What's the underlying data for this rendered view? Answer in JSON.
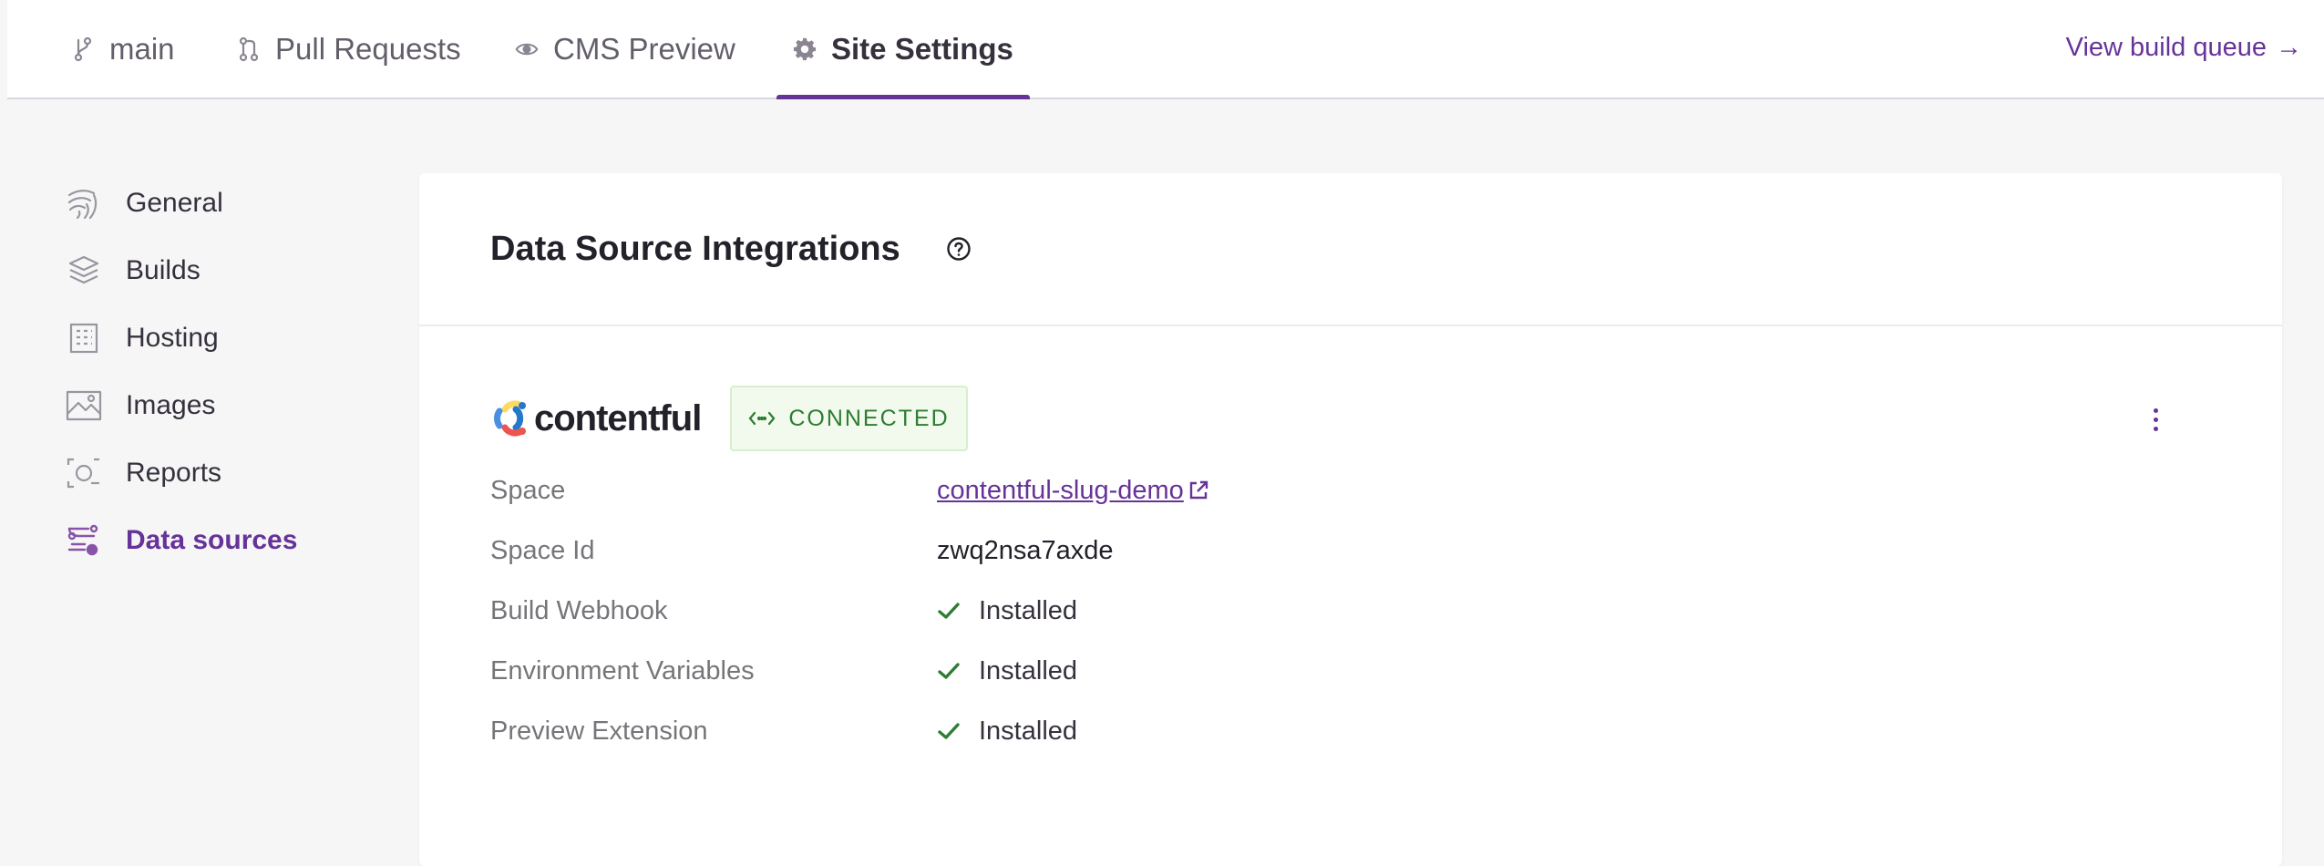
{
  "tabs": [
    {
      "label": "main",
      "icon": "git-branch-icon"
    },
    {
      "label": "Pull Requests",
      "icon": "pull-request-icon"
    },
    {
      "label": "CMS Preview",
      "icon": "eye-icon"
    },
    {
      "label": "Site Settings",
      "icon": "gear-icon",
      "active": true
    }
  ],
  "header": {
    "build_queue_label": "View build queue",
    "build_queue_arrow": "→"
  },
  "sidebar": {
    "items": [
      {
        "label": "General",
        "icon": "general-icon"
      },
      {
        "label": "Builds",
        "icon": "layers-icon"
      },
      {
        "label": "Hosting",
        "icon": "building-icon"
      },
      {
        "label": "Images",
        "icon": "image-icon"
      },
      {
        "label": "Reports",
        "icon": "reports-icon"
      },
      {
        "label": "Data sources",
        "icon": "data-sources-icon",
        "active": true
      }
    ]
  },
  "main": {
    "title": "Data Source Integrations",
    "integration": {
      "name": "contentful",
      "status": "CONNECTED",
      "rows": [
        {
          "label": "Space",
          "value": "contentful-slug-demo"
        },
        {
          "label": "Space Id",
          "value": "zwq2nsa7axde"
        },
        {
          "label": "Build Webhook",
          "value": "Installed"
        },
        {
          "label": "Environment Variables",
          "value": "Installed"
        },
        {
          "label": "Preview Extension",
          "value": "Installed"
        }
      ]
    }
  },
  "colors": {
    "accent": "#663399",
    "success": "#2e7d32",
    "background": "#f6f6f7"
  }
}
